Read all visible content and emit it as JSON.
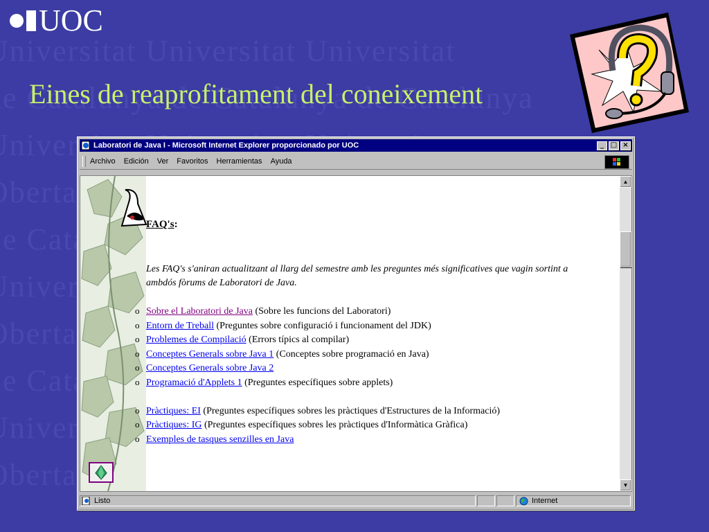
{
  "slide": {
    "logo_text": "UOC",
    "title": "Eines de reaprofitament del coneixement",
    "watermark_rows": [
      "Universitat  Universitat  Universitat",
      "de Catalunya  de Catalunya  de Catalunya",
      "Universitat  Universitat  Universitat",
      "Oberta  Oberta  Oberta  Oberta",
      "de Catalunya  de Catalunya  de Catalunya",
      "Universitat  Universitat  Universitat",
      "Oberta  Oberta  Oberta  Oberta",
      "de Catalunya  de Catalunya  de Catalunya",
      "Universitat  Universitat  Universitat",
      "Oberta  Oberta  Oberta  Oberta"
    ],
    "clipart_icon": "question-headset-icon"
  },
  "browser": {
    "title": "Laboratori de Java I - Microsoft Internet Explorer proporcionado por UOC",
    "buttons": {
      "minimize": "_",
      "maximize": "□",
      "close": "×"
    },
    "menu": [
      "Archivo",
      "Edición",
      "Ver",
      "Favoritos",
      "Herramientas",
      "Ayuda"
    ],
    "status": {
      "text": "Listo",
      "zone": "Internet"
    },
    "scroll": {
      "up": "▲",
      "down": "▼"
    }
  },
  "page": {
    "heading_link": "FAQ's",
    "heading_suffix": ":",
    "intro": "Les FAQ's s'aniran actualitzant al llarg del semestre amb les preguntes més significatives que vagin sortint a ambdós fòrums de Laboratori de Java.",
    "bullet": "o",
    "items_group1": [
      {
        "link": "Sobre el Laboratori de Java",
        "desc": " (Sobre les funcions del Laboratori)",
        "visited": true
      },
      {
        "link": "Entorn de Treball",
        "desc": " (Preguntes sobre configuració i funcionament del JDK)",
        "visited": false
      },
      {
        "link": "Problemes de Compilació",
        "desc": " (Errors típics al compilar)",
        "visited": false
      },
      {
        "link": "Conceptes Generals sobre Java 1",
        "desc": " (Conceptes sobre programació en Java)",
        "visited": false
      },
      {
        "link": "Conceptes Generals sobre Java 2",
        "desc": "",
        "visited": false
      },
      {
        "link": "Programació d'Applets 1",
        "desc": " (Preguntes específiques sobre applets)",
        "visited": false
      }
    ],
    "items_group2": [
      {
        "link": "Pràctiques: EI",
        "desc": " (Preguntes específiques sobres les pràctiques d'Estructures de la Informació)",
        "visited": false
      },
      {
        "link": "Pràctiques: IG",
        "desc": " (Preguntes específiques sobres les pràctiques d'Informàtica Gràfica)",
        "visited": false
      },
      {
        "link": "Exemples de tasques senzilles en Java",
        "desc": "",
        "visited": false
      }
    ]
  }
}
